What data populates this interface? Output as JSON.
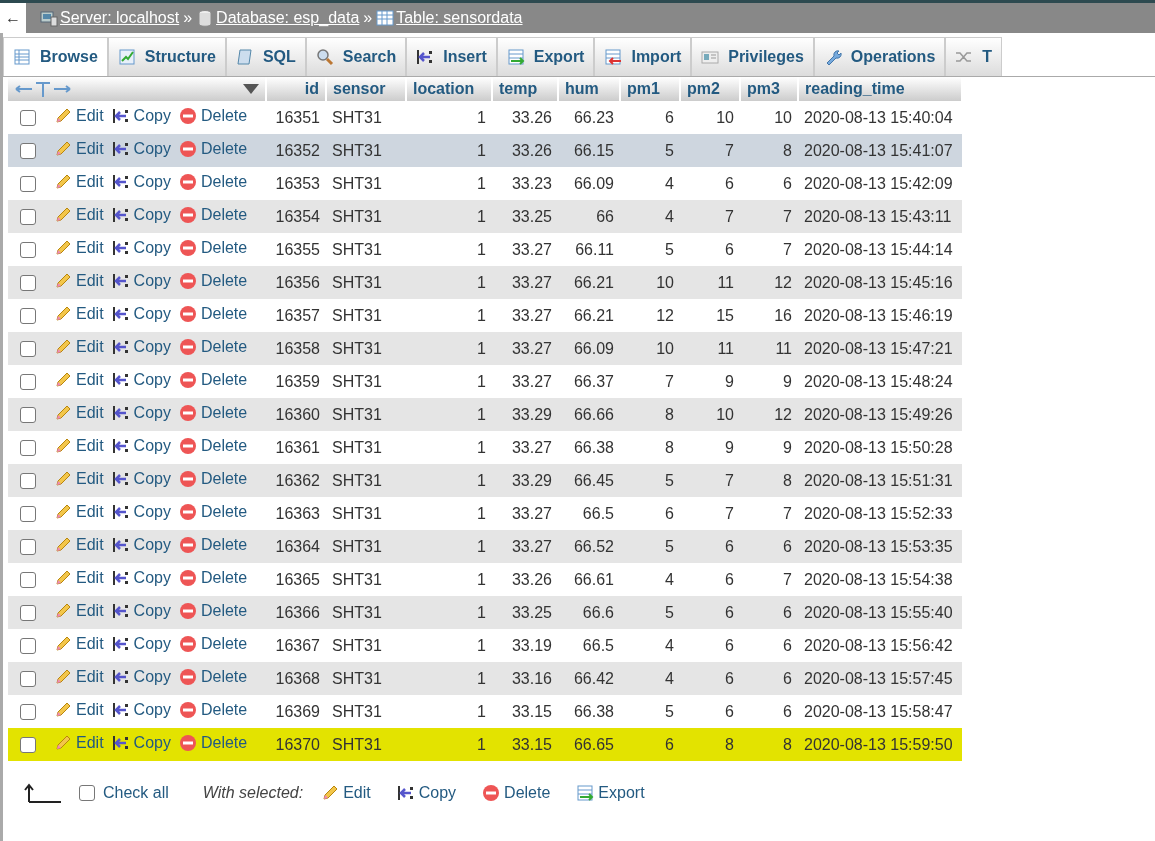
{
  "breadcrumb": [
    {
      "kind": "server",
      "label": "Server: localhost"
    },
    {
      "kind": "database",
      "label": "Database: esp_data"
    },
    {
      "kind": "table",
      "label": "Table: sensordata"
    }
  ],
  "breadcrumb_separator": "»",
  "back_button": "←",
  "tabs": [
    {
      "kind": "browse",
      "label": "Browse",
      "selected": true
    },
    {
      "kind": "structure",
      "label": "Structure",
      "selected": false
    },
    {
      "kind": "sql",
      "label": "SQL",
      "selected": false
    },
    {
      "kind": "search",
      "label": "Search",
      "selected": false
    },
    {
      "kind": "insert",
      "label": "Insert",
      "selected": false
    },
    {
      "kind": "export",
      "label": "Export",
      "selected": false
    },
    {
      "kind": "import",
      "label": "Import",
      "selected": false
    },
    {
      "kind": "privileges",
      "label": "Privileges",
      "selected": false
    },
    {
      "kind": "operations",
      "label": "Operations",
      "selected": false
    },
    {
      "kind": "tracking",
      "label": "T",
      "selected": false
    }
  ],
  "table": {
    "columns": [
      "id",
      "sensor",
      "location",
      "temp",
      "hum",
      "pm1",
      "pm2",
      "pm3",
      "reading_time"
    ],
    "rows": [
      {
        "checked": false,
        "hovered": false,
        "marked": false,
        "actions": [
          "Edit",
          "Copy",
          "Delete"
        ],
        "cells": [
          "16351",
          "SHT31",
          "1",
          "33.26",
          "66.23",
          "6",
          "10",
          "10",
          "2020-08-13 15:40:04"
        ]
      },
      {
        "checked": false,
        "hovered": true,
        "marked": false,
        "actions": [
          "Edit",
          "Copy",
          "Delete"
        ],
        "cells": [
          "16352",
          "SHT31",
          "1",
          "33.26",
          "66.15",
          "5",
          "7",
          "8",
          "2020-08-13 15:41:07"
        ]
      },
      {
        "checked": false,
        "hovered": false,
        "marked": false,
        "actions": [
          "Edit",
          "Copy",
          "Delete"
        ],
        "cells": [
          "16353",
          "SHT31",
          "1",
          "33.23",
          "66.09",
          "4",
          "6",
          "6",
          "2020-08-13 15:42:09"
        ]
      },
      {
        "checked": false,
        "hovered": false,
        "marked": false,
        "actions": [
          "Edit",
          "Copy",
          "Delete"
        ],
        "cells": [
          "16354",
          "SHT31",
          "1",
          "33.25",
          "66",
          "4",
          "7",
          "7",
          "2020-08-13 15:43:11"
        ]
      },
      {
        "checked": false,
        "hovered": false,
        "marked": false,
        "actions": [
          "Edit",
          "Copy",
          "Delete"
        ],
        "cells": [
          "16355",
          "SHT31",
          "1",
          "33.27",
          "66.11",
          "5",
          "6",
          "7",
          "2020-08-13 15:44:14"
        ]
      },
      {
        "checked": false,
        "hovered": false,
        "marked": false,
        "actions": [
          "Edit",
          "Copy",
          "Delete"
        ],
        "cells": [
          "16356",
          "SHT31",
          "1",
          "33.27",
          "66.21",
          "10",
          "11",
          "12",
          "2020-08-13 15:45:16"
        ]
      },
      {
        "checked": false,
        "hovered": false,
        "marked": false,
        "actions": [
          "Edit",
          "Copy",
          "Delete"
        ],
        "cells": [
          "16357",
          "SHT31",
          "1",
          "33.27",
          "66.21",
          "12",
          "15",
          "16",
          "2020-08-13 15:46:19"
        ]
      },
      {
        "checked": false,
        "hovered": false,
        "marked": false,
        "actions": [
          "Edit",
          "Copy",
          "Delete"
        ],
        "cells": [
          "16358",
          "SHT31",
          "1",
          "33.27",
          "66.09",
          "10",
          "11",
          "11",
          "2020-08-13 15:47:21"
        ]
      },
      {
        "checked": false,
        "hovered": false,
        "marked": false,
        "actions": [
          "Edit",
          "Copy",
          "Delete"
        ],
        "cells": [
          "16359",
          "SHT31",
          "1",
          "33.27",
          "66.37",
          "7",
          "9",
          "9",
          "2020-08-13 15:48:24"
        ]
      },
      {
        "checked": false,
        "hovered": false,
        "marked": false,
        "actions": [
          "Edit",
          "Copy",
          "Delete"
        ],
        "cells": [
          "16360",
          "SHT31",
          "1",
          "33.29",
          "66.66",
          "8",
          "10",
          "12",
          "2020-08-13 15:49:26"
        ]
      },
      {
        "checked": false,
        "hovered": false,
        "marked": false,
        "actions": [
          "Edit",
          "Copy",
          "Delete"
        ],
        "cells": [
          "16361",
          "SHT31",
          "1",
          "33.27",
          "66.38",
          "8",
          "9",
          "9",
          "2020-08-13 15:50:28"
        ]
      },
      {
        "checked": false,
        "hovered": false,
        "marked": false,
        "actions": [
          "Edit",
          "Copy",
          "Delete"
        ],
        "cells": [
          "16362",
          "SHT31",
          "1",
          "33.29",
          "66.45",
          "5",
          "7",
          "8",
          "2020-08-13 15:51:31"
        ]
      },
      {
        "checked": false,
        "hovered": false,
        "marked": false,
        "actions": [
          "Edit",
          "Copy",
          "Delete"
        ],
        "cells": [
          "16363",
          "SHT31",
          "1",
          "33.27",
          "66.5",
          "6",
          "7",
          "7",
          "2020-08-13 15:52:33"
        ]
      },
      {
        "checked": false,
        "hovered": false,
        "marked": false,
        "actions": [
          "Edit",
          "Copy",
          "Delete"
        ],
        "cells": [
          "16364",
          "SHT31",
          "1",
          "33.27",
          "66.52",
          "5",
          "6",
          "6",
          "2020-08-13 15:53:35"
        ]
      },
      {
        "checked": false,
        "hovered": false,
        "marked": false,
        "actions": [
          "Edit",
          "Copy",
          "Delete"
        ],
        "cells": [
          "16365",
          "SHT31",
          "1",
          "33.26",
          "66.61",
          "4",
          "6",
          "7",
          "2020-08-13 15:54:38"
        ]
      },
      {
        "checked": false,
        "hovered": false,
        "marked": false,
        "actions": [
          "Edit",
          "Copy",
          "Delete"
        ],
        "cells": [
          "16366",
          "SHT31",
          "1",
          "33.25",
          "66.6",
          "5",
          "6",
          "6",
          "2020-08-13 15:55:40"
        ]
      },
      {
        "checked": false,
        "hovered": false,
        "marked": false,
        "actions": [
          "Edit",
          "Copy",
          "Delete"
        ],
        "cells": [
          "16367",
          "SHT31",
          "1",
          "33.19",
          "66.5",
          "4",
          "6",
          "6",
          "2020-08-13 15:56:42"
        ]
      },
      {
        "checked": false,
        "hovered": false,
        "marked": false,
        "actions": [
          "Edit",
          "Copy",
          "Delete"
        ],
        "cells": [
          "16368",
          "SHT31",
          "1",
          "33.16",
          "66.42",
          "4",
          "6",
          "6",
          "2020-08-13 15:57:45"
        ]
      },
      {
        "checked": false,
        "hovered": false,
        "marked": false,
        "actions": [
          "Edit",
          "Copy",
          "Delete"
        ],
        "cells": [
          "16369",
          "SHT31",
          "1",
          "33.15",
          "66.38",
          "5",
          "6",
          "6",
          "2020-08-13 15:58:47"
        ]
      },
      {
        "checked": false,
        "hovered": false,
        "marked": true,
        "actions": [
          "Edit",
          "Copy",
          "Delete"
        ],
        "cells": [
          "16370",
          "SHT31",
          "1",
          "33.15",
          "66.65",
          "6",
          "8",
          "8",
          "2020-08-13 15:59:50"
        ]
      }
    ]
  },
  "footer": {
    "check_all": {
      "label": "Check all",
      "checked": false
    },
    "with_selected": "With selected:",
    "buttons": [
      {
        "kind": "edit",
        "label": "Edit"
      },
      {
        "kind": "copy",
        "label": "Copy"
      },
      {
        "kind": "delete",
        "label": "Delete"
      },
      {
        "kind": "export",
        "label": "Export"
      }
    ]
  }
}
